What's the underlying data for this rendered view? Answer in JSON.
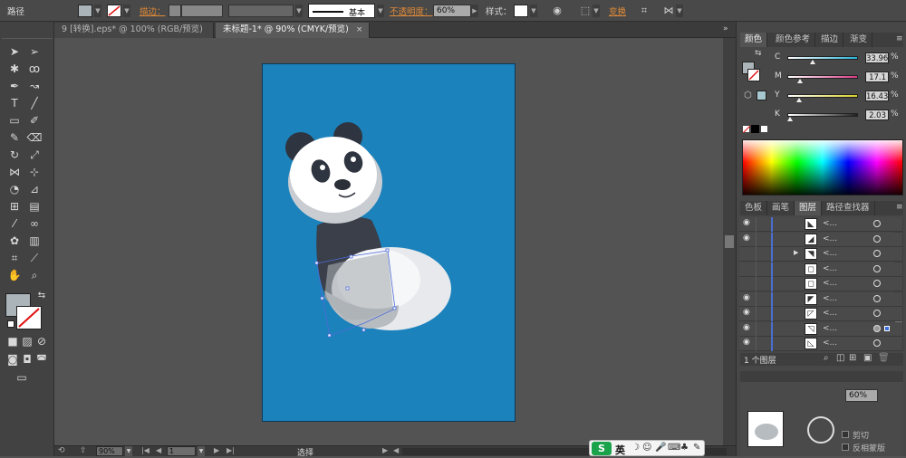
{
  "control_bar": {
    "object_type": "路径",
    "stroke_label": "描边：",
    "stroke_profile": "基本",
    "opacity_label": "不透明度：",
    "opacity_value": "60%",
    "style_label": "样式：",
    "transform_label": "变换",
    "fill_color": "#aab4b9"
  },
  "doc_tabs": [
    {
      "label": "9 [转换].eps* @ 100% (RGB/预览)",
      "active": false
    },
    {
      "label": "未标题-1* @ 90% (CMYK/预览)",
      "active": true
    }
  ],
  "tools": [
    [
      "selection-tool",
      "direct-selection-tool"
    ],
    [
      "magic-wand-tool",
      "lasso-tool"
    ],
    [
      "pen-tool",
      "curvature-tool"
    ],
    [
      "type-tool",
      "line-tool"
    ],
    [
      "rectangle-tool",
      "paintbrush-tool"
    ],
    [
      "pencil-tool",
      "eraser-tool"
    ],
    [
      "rotate-tool",
      "scale-tool"
    ],
    [
      "width-tool",
      "free-transform-tool"
    ],
    [
      "shape-builder-tool",
      "perspective-grid-tool"
    ],
    [
      "mesh-tool",
      "gradient-tool"
    ],
    [
      "eyedropper-tool",
      "blend-tool"
    ],
    [
      "symbol-sprayer-tool",
      "column-graph-tool"
    ],
    [
      "artboard-tool",
      "slice-tool"
    ],
    [
      "hand-tool",
      "zoom-tool"
    ]
  ],
  "color_panel": {
    "tabs": [
      "颜色",
      "颜色参考",
      "描边",
      "渐变"
    ],
    "sliders": [
      {
        "label": "C",
        "value": "33.96",
        "color": "#29b3d9",
        "pos": 0.34
      },
      {
        "label": "M",
        "value": "17.1",
        "color": "#d63a86",
        "pos": 0.17
      },
      {
        "label": "Y",
        "value": "16.43",
        "color": "#d9cf2a",
        "pos": 0.16
      },
      {
        "label": "K",
        "value": "2.03",
        "color": "#202020",
        "pos": 0.02
      }
    ],
    "unit": "%"
  },
  "layers_panel": {
    "tabs": [
      "色板",
      "画笔",
      "图层",
      "路径查找器"
    ],
    "rows": [
      {
        "name": "<...",
        "visible": true
      },
      {
        "name": "<...",
        "visible": true
      },
      {
        "name": "<...",
        "visible": false
      },
      {
        "name": "<...",
        "visible": false
      },
      {
        "name": "<...",
        "visible": false
      },
      {
        "name": "<...",
        "visible": true
      },
      {
        "name": "<...",
        "visible": true
      },
      {
        "name": "<...",
        "visible": true
      },
      {
        "name": "<...",
        "visible": true
      }
    ],
    "footer_count": "1 个图层"
  },
  "transparency_panel": {
    "opacity": "60%",
    "clip_label": "剪切",
    "invert_mask_label": "反相蒙版"
  },
  "status_bar": {
    "zoom": "90%",
    "artboard": "1",
    "tool_status": "选择"
  },
  "ime": {
    "logo": "S",
    "lang": "英"
  }
}
